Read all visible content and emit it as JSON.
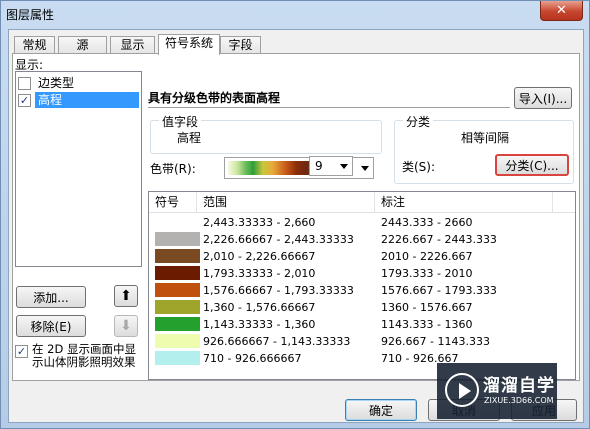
{
  "window": {
    "title": "图层属性",
    "close_glyph": "✕"
  },
  "tabs": [
    {
      "label": "常规"
    },
    {
      "label": "源"
    },
    {
      "label": "显示"
    },
    {
      "label": "符号系统"
    },
    {
      "label": "字段"
    }
  ],
  "left": {
    "show_label": "显示:",
    "items": [
      {
        "label": "边类型",
        "checked": false,
        "selected": false
      },
      {
        "label": "高程",
        "checked": true,
        "selected": true
      }
    ],
    "add_button": "添加...",
    "remove_button": "移除(E)",
    "hillshade": {
      "checked": true,
      "line1": "在 2D 显示画面中显",
      "line2": "示山体阴影照明效果"
    }
  },
  "right": {
    "heading": "具有分级色带的表面高程",
    "import_button": "导入(I)...",
    "value_field": {
      "title": "值字段",
      "value": "高程"
    },
    "classification": {
      "title": "分类",
      "method": "相等间隔",
      "classes_label": "类(S):",
      "classes_value": "9",
      "classify_button": "分类(C)..."
    },
    "color_ramp_label": "色带(R):",
    "table": {
      "headers": {
        "symbol": "符号",
        "range": "范围",
        "label": "标注"
      },
      "rows": [
        {
          "color": "#ffffff",
          "range": "2,443.33333 - 2,660",
          "label": "2443.333 - 2660"
        },
        {
          "color": "#b4b1b1",
          "range": "2,226.66667 - 2,443.33333",
          "label": "2226.667 - 2443.333"
        },
        {
          "color": "#7a4a22",
          "range": "2,010 - 2,226.66667",
          "label": "2010 - 2226.667"
        },
        {
          "color": "#6b1b00",
          "range": "1,793.33333 - 2,010",
          "label": "1793.333 - 2010"
        },
        {
          "color": "#c0500e",
          "range": "1,576.66667 - 1,793.33333",
          "label": "1576.667 - 1793.333"
        },
        {
          "color": "#9ea52a",
          "range": "1,360 - 1,576.66667",
          "label": "1360 - 1576.667"
        },
        {
          "color": "#23a02e",
          "range": "1,143.33333 - 1,360",
          "label": "1143.333 - 1360"
        },
        {
          "color": "#eefcb0",
          "range": "926.666667 - 1,143.33333",
          "label": "926.667 - 1143.333"
        },
        {
          "color": "#b3f0ed",
          "range": "710 - 926.666667",
          "label": "710 - 926.667"
        }
      ]
    }
  },
  "footer": {
    "ok_button": "确定",
    "cancel_button": "取消",
    "apply_button": "应用"
  },
  "watermark": {
    "name": "溜溜自学",
    "url": "ZIXUE.3D66.COM"
  }
}
